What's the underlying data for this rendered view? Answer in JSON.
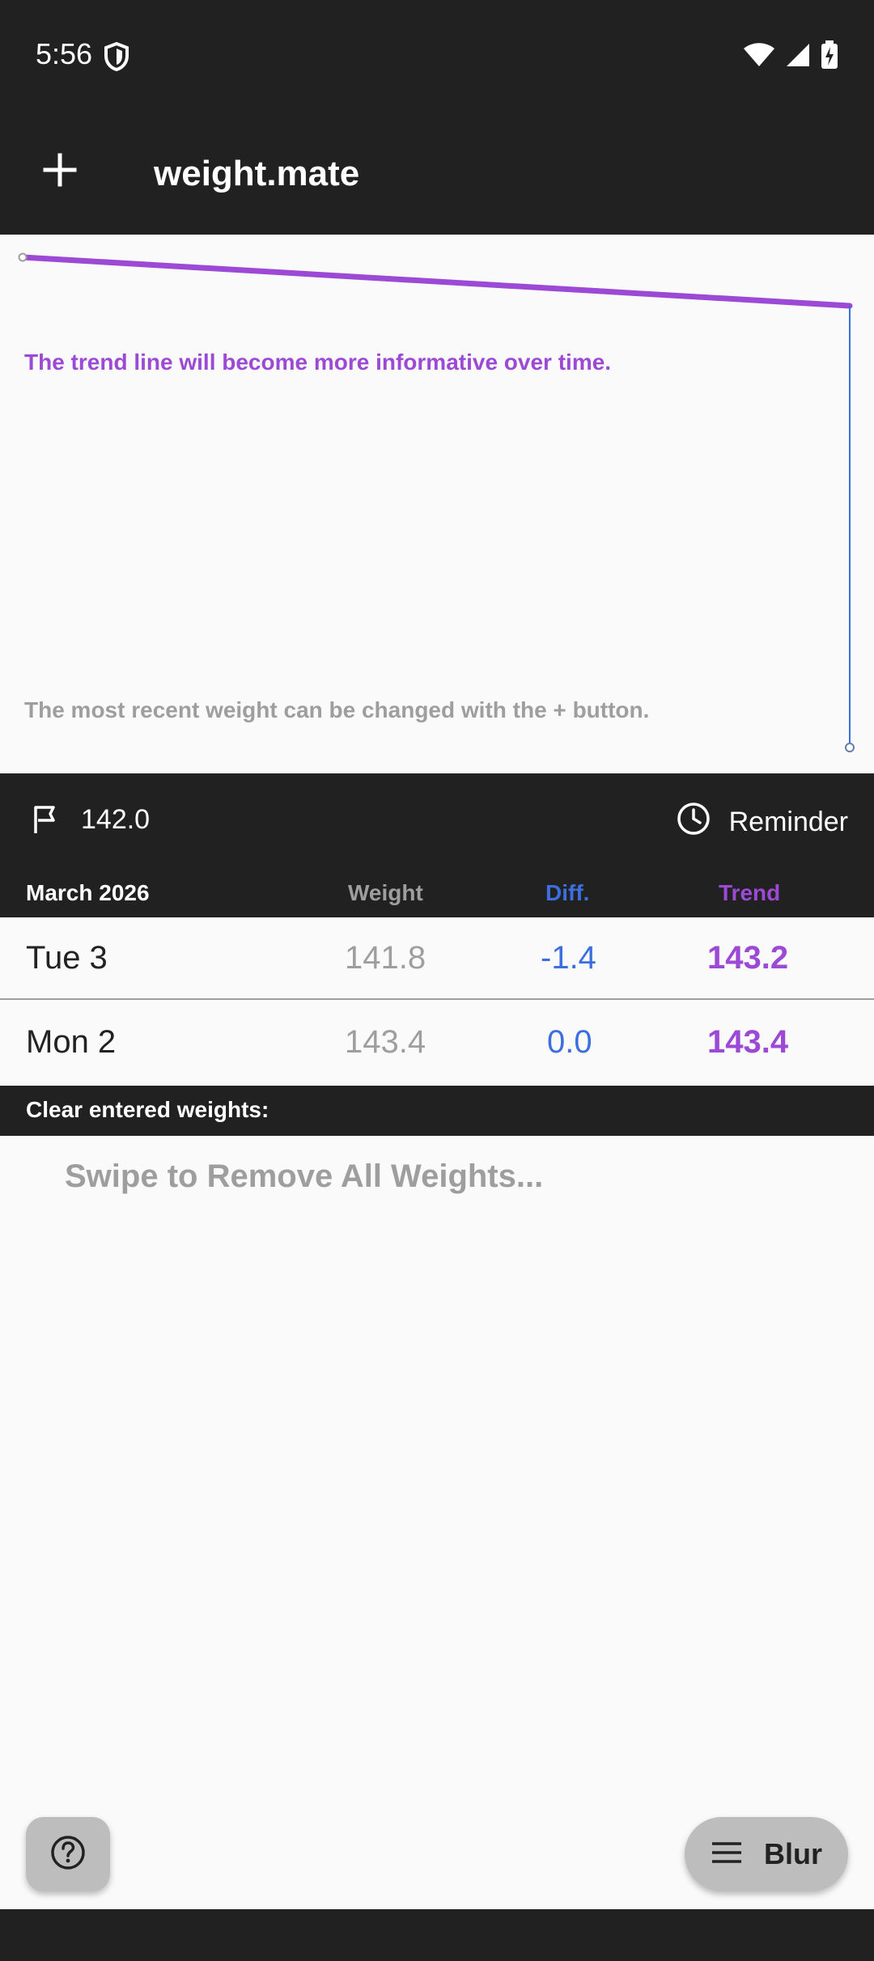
{
  "status_bar": {
    "time": "5:56"
  },
  "app_bar": {
    "title": "weight.mate"
  },
  "chart": {
    "message_top": "The trend line will become more informative over time.",
    "message_bottom": "The most recent weight can be changed with the + button."
  },
  "goal": {
    "value": "142.0"
  },
  "reminder": {
    "label": "Reminder"
  },
  "table": {
    "month": "March 2026",
    "headers": {
      "weight": "Weight",
      "diff": "Diff.",
      "trend": "Trend"
    },
    "rows": [
      {
        "day": "Tue 3",
        "weight": "141.8",
        "diff": "-1.4",
        "trend": "143.2"
      },
      {
        "day": "Mon 2",
        "weight": "143.4",
        "diff": "0.0",
        "trend": "143.4"
      }
    ]
  },
  "clear": {
    "label": "Clear entered weights:",
    "swipe_text": "Swipe to Remove All Weights..."
  },
  "buttons": {
    "blur": "Blur"
  },
  "icons": {
    "add": "plus-icon",
    "goal": "flag-icon",
    "reminder": "clock-icon",
    "help": "help-circle-icon",
    "menu": "menu-icon",
    "status_shield": "shield-icon",
    "wifi": "wifi-icon",
    "signal": "signal-icon",
    "battery": "battery-icon"
  },
  "colors": {
    "dark_bar": "#212121",
    "trend_purple": "#9c4ad6",
    "diff_blue": "#3d6ee0",
    "muted_gray": "#9e9e9e"
  }
}
